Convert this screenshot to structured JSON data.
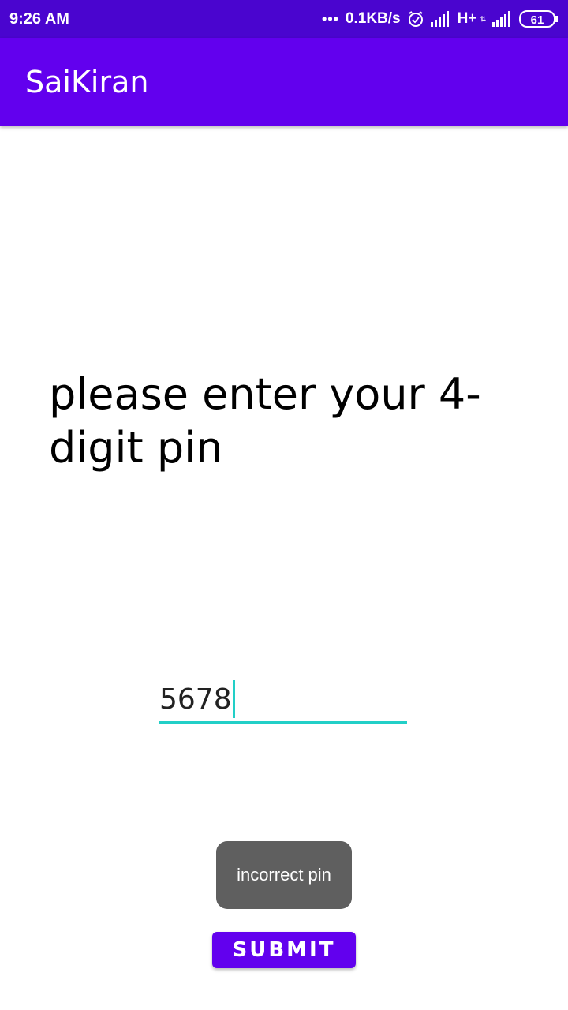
{
  "status_bar": {
    "time": "9:26 AM",
    "more_indicator": "•••",
    "network_speed": "0.1KB/s",
    "alarm_icon": "alarm-clock-icon",
    "signal_icon": "signal-bars-icon",
    "network_type": "H+",
    "battery_level": "61"
  },
  "app_bar": {
    "title": "SaiKiran",
    "color": "#6200ee"
  },
  "main": {
    "prompt": "please enter your 4-digit pin",
    "pin_input_value": "5678",
    "input_accent_color": "#22cfc7",
    "toast_message": "incorrect pin",
    "submit_label": "SUBMIT"
  }
}
